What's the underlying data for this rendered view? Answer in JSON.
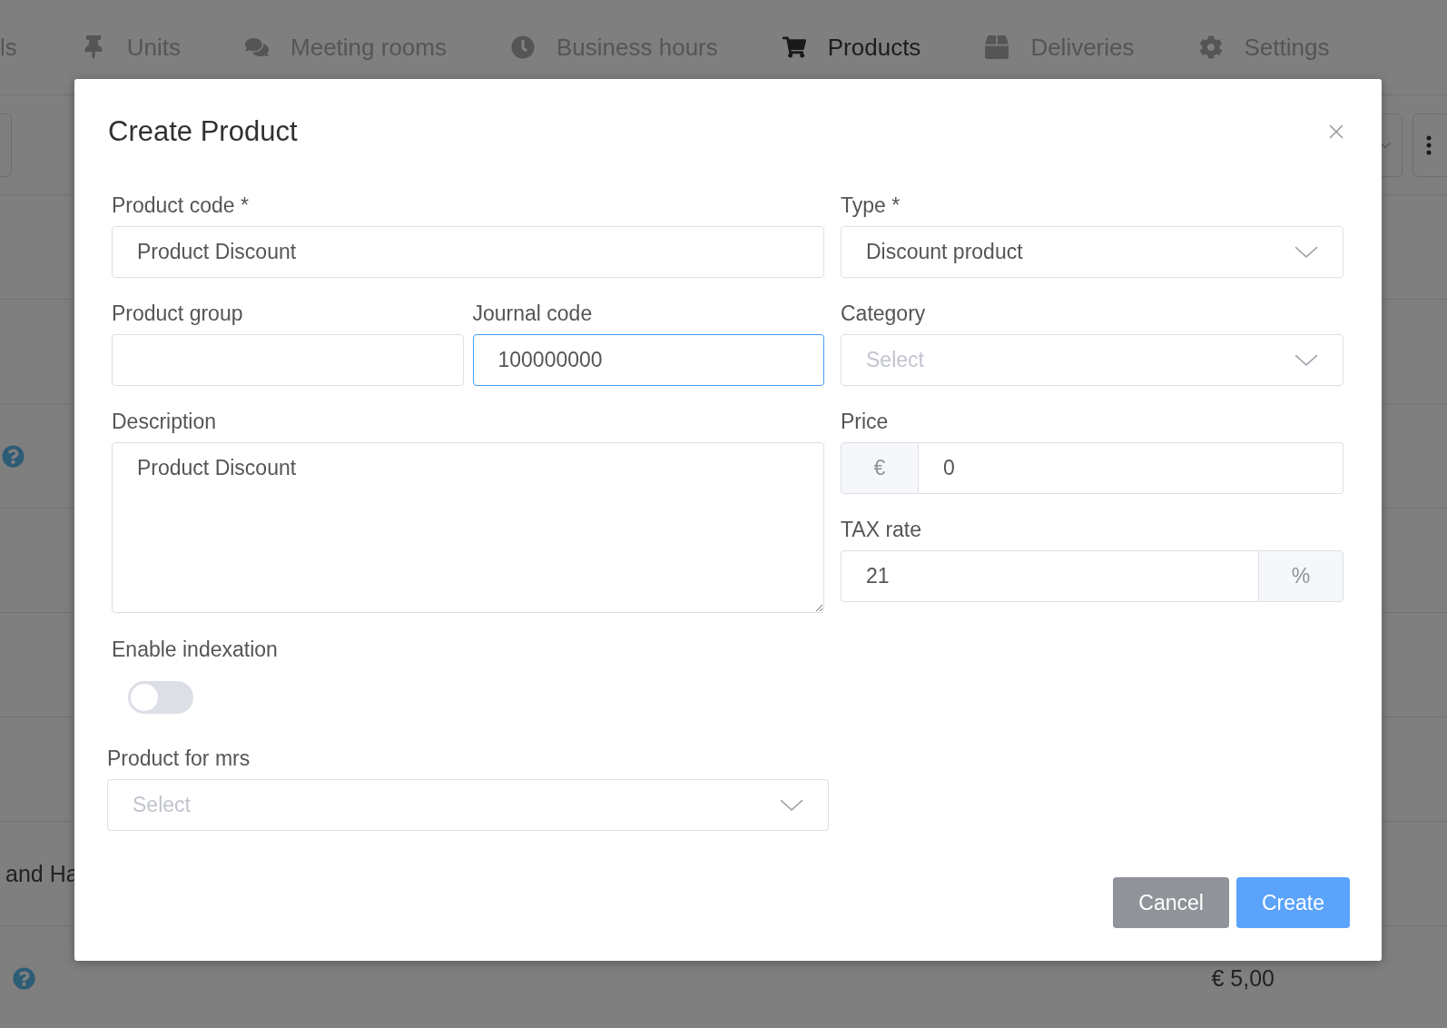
{
  "nav": {
    "tabs": [
      {
        "label": "ls",
        "selected": false
      },
      {
        "label": "Units",
        "selected": false
      },
      {
        "label": "Meeting rooms",
        "selected": false
      },
      {
        "label": "Business hours",
        "selected": false
      },
      {
        "label": "Products",
        "selected": true
      },
      {
        "label": "Deliveries",
        "selected": false
      },
      {
        "label": "Settings",
        "selected": false
      }
    ]
  },
  "table": {
    "rows": [
      {
        "help": false
      },
      {
        "help": false
      },
      {
        "help": true
      },
      {
        "help": false
      },
      {
        "help": false
      },
      {
        "help": false
      },
      {
        "label": "and Ha",
        "help": false
      },
      {
        "help": true,
        "price": "€ 5,00"
      }
    ]
  },
  "modal": {
    "title": "Create Product",
    "product_code": {
      "label": "Product code *",
      "value": "Product Discount"
    },
    "type": {
      "label": "Type *",
      "value": "Discount product"
    },
    "product_group": {
      "label": "Product group"
    },
    "journal_code": {
      "label": "Journal code",
      "value": "100000000",
      "focused": true
    },
    "category": {
      "label": "Category",
      "placeholder": "Select"
    },
    "description": {
      "label": "Description",
      "value": "Product Discount"
    },
    "price": {
      "label": "Price",
      "prefix": "€",
      "value": "0"
    },
    "tax_rate": {
      "label": "TAX rate",
      "value": "21",
      "suffix": "%"
    },
    "indexation": {
      "label": "Enable indexation",
      "on": false
    },
    "product_for_mrs": {
      "label": "Product for mrs",
      "placeholder": "Select"
    },
    "buttons": {
      "cancel": "Cancel",
      "create": "Create"
    }
  }
}
